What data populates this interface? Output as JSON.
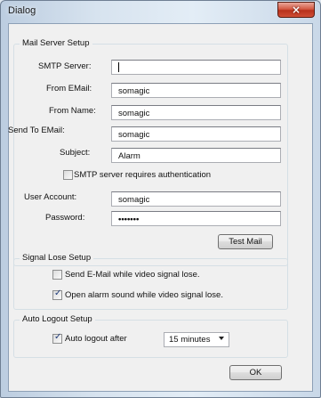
{
  "window": {
    "title": "Dialog",
    "close_glyph": "×"
  },
  "mail": {
    "group_title": "Mail Server Setup",
    "smtp_label": "SMTP Server:",
    "smtp_value": "",
    "from_email_label": "From EMail:",
    "from_email_value": "somagic",
    "from_name_label": "From Name:",
    "from_name_value": "somagic",
    "send_to_label": "Send To EMail:",
    "send_to_value": "somagic",
    "subject_label": "Subject:",
    "subject_value": "Alarm",
    "auth_label": "SMTP server requires authentication",
    "auth_checked": false,
    "account_label": "User Account:",
    "account_value": "somagic",
    "password_label": "Password:",
    "password_value": "•••••••",
    "test_button": "Test Mail"
  },
  "signal": {
    "group_title": "Signal Lose Setup",
    "send_email_label": "Send E-Mail while video signal lose.",
    "send_email_checked": false,
    "alarm_sound_label": "Open alarm sound while video signal lose.",
    "alarm_sound_checked": true
  },
  "logout": {
    "group_title": "Auto Logout Setup",
    "auto_logout_label": "Auto logout after",
    "auto_logout_checked": true,
    "duration_selected": "15 minutes"
  },
  "footer": {
    "ok_button": "OK"
  },
  "icons": {
    "close": "close-icon",
    "dropdown": "chevron-down-icon",
    "check": "checkmark-icon"
  }
}
